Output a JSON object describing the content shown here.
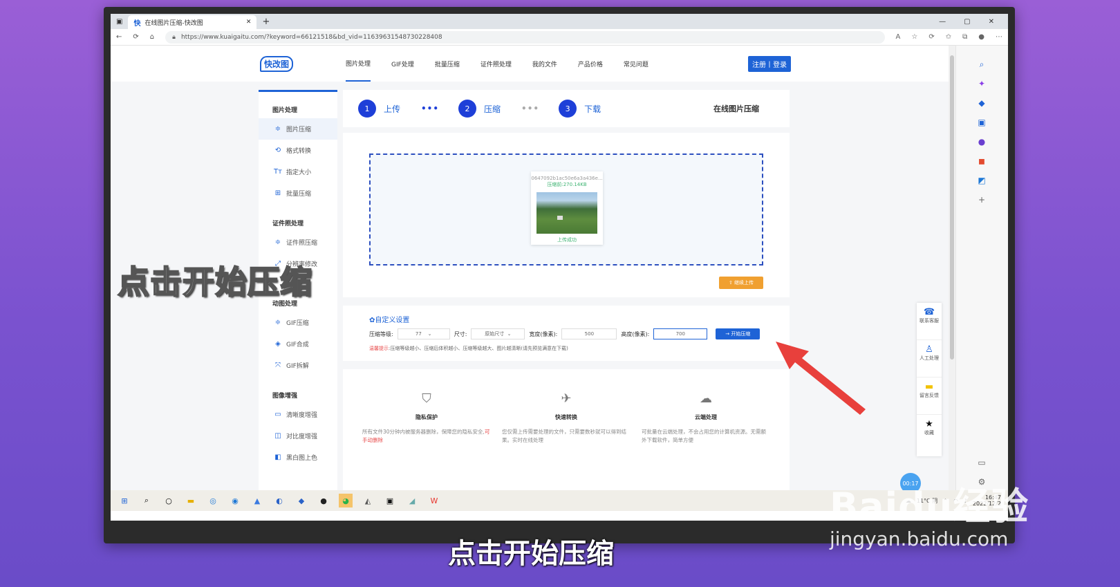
{
  "browser": {
    "tab_title": "在线图片压缩-快改图",
    "tab_favicon": "快",
    "url": "https://www.kuaigaitu.com/?keyword=66121518&bd_vid=11639631548730228408"
  },
  "site": {
    "logo": "快改图",
    "nav": [
      "图片处理",
      "GIF处理",
      "批量压缩",
      "证件照处理",
      "我的文件",
      "产品价格",
      "常见问题"
    ],
    "register_login": "注册丨登录"
  },
  "sidebar": {
    "groups": [
      {
        "title": "图片处理",
        "items": [
          {
            "icon": "compress-icon",
            "glyph": "≑",
            "label": "图片压缩"
          },
          {
            "icon": "convert-icon",
            "glyph": "⟲",
            "label": "格式转换"
          },
          {
            "icon": "text-size-icon",
            "glyph": "Tт",
            "label": "指定大小"
          },
          {
            "icon": "batch-icon",
            "glyph": "⊞",
            "label": "批量压缩"
          }
        ]
      },
      {
        "title": "证件照处理",
        "items": [
          {
            "icon": "compress-icon",
            "glyph": "≑",
            "label": "证件照压缩"
          },
          {
            "icon": "expand-icon",
            "glyph": "⤢",
            "label": "分辨率修改"
          }
        ]
      },
      {
        "title": "动图处理",
        "items": [
          {
            "icon": "compress-icon",
            "glyph": "≑",
            "label": "GIF压缩"
          },
          {
            "icon": "layers-icon",
            "glyph": "◈",
            "label": "GIF合成"
          },
          {
            "icon": "split-icon",
            "glyph": "⤧",
            "label": "GIF拆解"
          }
        ]
      },
      {
        "title": "图像增强",
        "items": [
          {
            "icon": "hd-icon",
            "glyph": "▭",
            "label": "清晰度增强"
          },
          {
            "icon": "contrast-icon",
            "glyph": "◫",
            "label": "对比度增强"
          },
          {
            "icon": "colorize-icon",
            "glyph": "◧",
            "label": "黑白图上色"
          }
        ]
      }
    ]
  },
  "steps": {
    "items": [
      {
        "num": "1",
        "label": "上传"
      },
      {
        "num": "2",
        "label": "压缩"
      },
      {
        "num": "3",
        "label": "下载"
      }
    ],
    "dots": "•••",
    "page_title": "在线图片压缩"
  },
  "upload": {
    "file_name": "0647092b1ac50e6a3a436e...",
    "file_size": "压缩前:270.14KB",
    "status": "上传成功",
    "reupload_label": "⇧ 继续上传"
  },
  "settings": {
    "title": "✿自定义设置",
    "level_label": "压缩等级:",
    "level_value": "77",
    "size_label": "尺寸:",
    "size_value": "原始尺寸",
    "width_label": "宽度(像素):",
    "width_value": "500",
    "height_label": "高度(像素):",
    "height_value": "700",
    "start_label": "→ 开始压缩",
    "tip_prefix": "温馨提示",
    "tip_text": ":压缩等级越小、压缩后体积越小、压缩等级越大、图片越清晰(请先预览满意在下载)"
  },
  "features": [
    {
      "icon": "shield-icon",
      "glyph": "⛉",
      "title": "隐私保护",
      "desc": "所有文件30分钟内被服务器删除，保障您的隐私安全,",
      "link": "可手动删除"
    },
    {
      "icon": "rocket-icon",
      "glyph": "✈",
      "title": "快速转换",
      "desc": "您仅需上传需要处理的文件，只需要数秒就可以得到结果。实时在线处理",
      "link": ""
    },
    {
      "icon": "cloud-icon",
      "glyph": "☁",
      "title": "云端处理",
      "desc": "可批量在云端处理，不会占用您的计算机资源。无需额外下载软件，简单方便",
      "link": ""
    }
  ],
  "float_panel": [
    {
      "icon": "service-icon",
      "glyph": "☎",
      "label": "联系客服"
    },
    {
      "icon": "person-icon",
      "glyph": "♙",
      "label": "人工处理"
    },
    {
      "icon": "message-icon",
      "glyph": "▬",
      "label": "留言反馈"
    },
    {
      "icon": "star-icon",
      "glyph": "★",
      "label": "收藏"
    }
  ],
  "timer": "00:17",
  "taskbar": {
    "weather": "11°C 阴",
    "time": "16:47",
    "date": "2022/12/2"
  },
  "overlay": {
    "big_caption": "点击开始压缩",
    "subtitle": "点击开始压缩",
    "watermark_main": "Baidu经验",
    "watermark_url": "jingyan.baidu.com"
  },
  "colors": {
    "accent": "#1e63d6",
    "arrow": "#e8403c",
    "warn": "#e84d4d",
    "success": "#3cb371",
    "orange": "#f0a030"
  }
}
